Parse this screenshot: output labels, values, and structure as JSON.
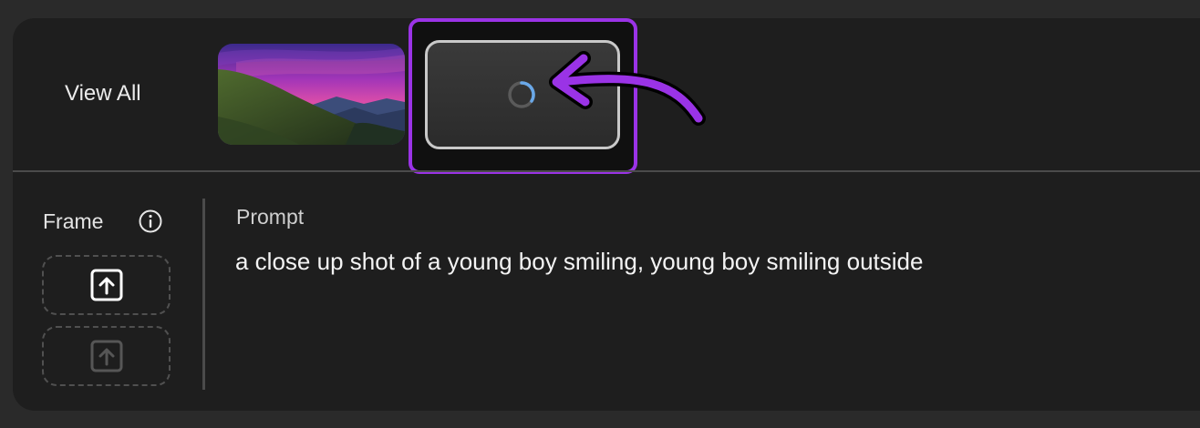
{
  "gallery": {
    "view_all_label": "View All",
    "thumbnails": [
      {
        "icon": "landscape-thumbnail",
        "state": "ready"
      },
      {
        "icon": "loading-spinner-icon",
        "state": "generating"
      }
    ]
  },
  "annotation": {
    "highlight_color": "#9a33e6",
    "arrow_icon": "curved-arrow-icon"
  },
  "frame": {
    "label": "Frame",
    "info_icon": "info-icon",
    "upload_icon": "upload-icon"
  },
  "prompt": {
    "label": "Prompt",
    "value": "a close up shot of a young boy smiling, young boy smiling outside"
  },
  "colors": {
    "panel_bg": "#1e1e1e",
    "page_bg": "#2a2a2a",
    "accent_purple": "#9a33e6",
    "spinner_blue": "#6aa8e8"
  }
}
